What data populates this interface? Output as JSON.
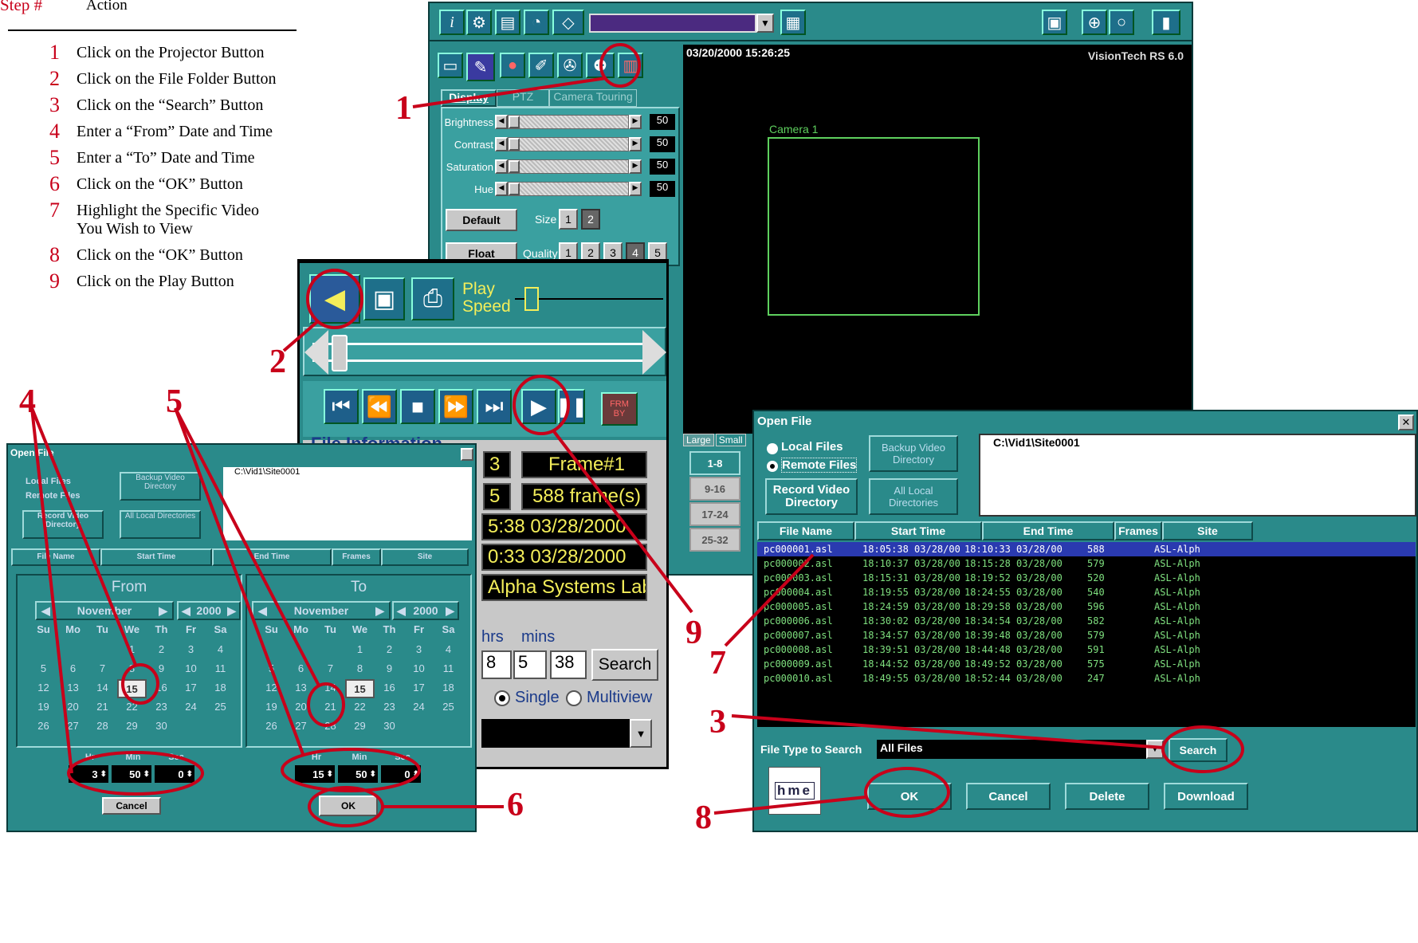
{
  "steps": {
    "header_step": "Step #",
    "header_action": "Action",
    "items": [
      {
        "num": "1",
        "text": "Click on the Projector Button"
      },
      {
        "num": "2",
        "text": "Click on the File Folder Button"
      },
      {
        "num": "3",
        "text": "Click on the “Search” Button"
      },
      {
        "num": "4",
        "text": "Enter a “From” Date and Time"
      },
      {
        "num": "5",
        "text": "Enter a “To” Date and Time"
      },
      {
        "num": "6",
        "text": "Click on the “OK” Button"
      },
      {
        "num": "7",
        "text": "Highlight the Specific Video You Wish to View"
      },
      {
        "num": "8",
        "text": "Click on the “OK” Button"
      },
      {
        "num": "9",
        "text": "Click on the Play Button"
      }
    ]
  },
  "callouts": [
    "1",
    "2",
    "3",
    "4",
    "5",
    "6",
    "7",
    "8",
    "9"
  ],
  "main_window": {
    "timestamp": "03/20/2000 15:26:25",
    "brand": "VisionTech RS 6.0",
    "camera_label": "Camera 1",
    "tabs": [
      "Display",
      "PTZ",
      "Camera Touring"
    ],
    "sliders": [
      {
        "label": "Brightness",
        "value": "50"
      },
      {
        "label": "Contrast",
        "value": "50"
      },
      {
        "label": "Saturation",
        "value": "50"
      },
      {
        "label": "Hue",
        "value": "50"
      }
    ],
    "default_button": "Default",
    "float_button": "Float",
    "size_label": "Size",
    "size_options": [
      "1",
      "2"
    ],
    "quality_label": "Quality",
    "quality_options": [
      "1",
      "2",
      "3",
      "4",
      "5"
    ],
    "view_tabs": [
      "Large",
      "Small"
    ],
    "camera_groups": [
      "1-8",
      "9-16",
      "17-24",
      "25-32"
    ]
  },
  "player": {
    "play_speed_label": "Play\nSpeed",
    "file_info_title": "File Information",
    "frame_label": "Frame#1",
    "frame_count": "588 frame(s)",
    "start_time": "5:38 03/28/2000",
    "end_time": "0:33 03/28/2000",
    "site_name": "Alpha Systems Lab",
    "hrs_label": "hrs",
    "mins_label": "mins",
    "frag_field_a": "3",
    "frag_field_b": "5",
    "time_hrs": "8",
    "time_mins": "5",
    "time_secs": "38",
    "search_button": "Search",
    "single_label": "Single",
    "multiview_label": "Multiview",
    "frag_button": "FRM\nBY"
  },
  "open_file_right": {
    "title": "Open File",
    "local_files": "Local Files",
    "remote_files": "Remote Files",
    "backup_video_dir": "Backup Video Directory",
    "record_video_dir": "Record Video Directory",
    "all_local_dirs": "All Local Directories",
    "path": "C:\\Vid1\\Site0001",
    "columns": [
      "File Name",
      "Start Time",
      "End Time",
      "Frames",
      "Site"
    ],
    "rows": [
      [
        "pc000001.asl",
        "18:05:38 03/28/00",
        "18:10:33 03/28/00",
        "588",
        "ASL-Alph"
      ],
      [
        "pc000002.asl",
        "18:10:37 03/28/00",
        "18:15:28 03/28/00",
        "579",
        "ASL-Alph"
      ],
      [
        "pc000003.asl",
        "18:15:31 03/28/00",
        "18:19:52 03/28/00",
        "520",
        "ASL-Alph"
      ],
      [
        "pc000004.asl",
        "18:19:55 03/28/00",
        "18:24:55 03/28/00",
        "540",
        "ASL-Alph"
      ],
      [
        "pc000005.asl",
        "18:24:59 03/28/00",
        "18:29:58 03/28/00",
        "596",
        "ASL-Alph"
      ],
      [
        "pc000006.asl",
        "18:30:02 03/28/00",
        "18:34:54 03/28/00",
        "582",
        "ASL-Alph"
      ],
      [
        "pc000007.asl",
        "18:34:57 03/28/00",
        "18:39:48 03/28/00",
        "579",
        "ASL-Alph"
      ],
      [
        "pc000008.asl",
        "18:39:51 03/28/00",
        "18:44:48 03/28/00",
        "591",
        "ASL-Alph"
      ],
      [
        "pc000009.asl",
        "18:44:52 03/28/00",
        "18:49:52 03/28/00",
        "575",
        "ASL-Alph"
      ],
      [
        "pc000010.asl",
        "18:49:55 03/28/00",
        "18:52:44 03/28/00",
        "247",
        "ASL-Alph"
      ]
    ],
    "file_type_label": "File Type to Search",
    "file_type_value": "All Files",
    "search_button": "Search",
    "logo": "hme",
    "ok_button": "OK",
    "cancel_button": "Cancel",
    "delete_button": "Delete",
    "download_button": "Download"
  },
  "open_file_left": {
    "title": "Open File",
    "local_files": "Local Files",
    "remote_files": "Remote Files",
    "backup_video_dir": "Backup Video Directory",
    "record_video_dir": "Record Video Directory",
    "all_local_dirs": "All Local Directories",
    "path": "C:\\Vid1\\Site0001",
    "columns": [
      "File Name",
      "Start Time",
      "End Time",
      "Frames",
      "Site"
    ],
    "from_label": "From",
    "to_label": "To",
    "from_month": "November",
    "from_year": "2000",
    "to_month": "November",
    "to_year": "2000",
    "weekdays": [
      "Su",
      "Mo",
      "Tu",
      "We",
      "Th",
      "Fr",
      "Sa"
    ],
    "days": [
      "",
      "",
      "",
      "1",
      "2",
      "3",
      "4",
      "5",
      "6",
      "7",
      "8",
      "9",
      "10",
      "11",
      "12",
      "13",
      "14",
      "15",
      "16",
      "17",
      "18",
      "19",
      "20",
      "21",
      "22",
      "23",
      "24",
      "25",
      "26",
      "27",
      "28",
      "29",
      "30"
    ],
    "from_selected": "15",
    "to_selected": "15",
    "time_headers": [
      "Hr",
      "Min",
      "Sec"
    ],
    "from_time": [
      "3",
      "50",
      "0"
    ],
    "to_time": [
      "15",
      "50",
      "0"
    ],
    "cancel_button": "Cancel",
    "ok_button": "OK"
  }
}
